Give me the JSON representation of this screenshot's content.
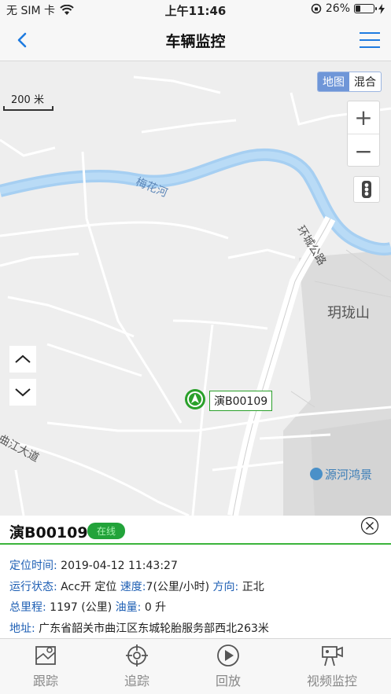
{
  "status_bar": {
    "carrier": "无 SIM 卡",
    "time": "上午11:46",
    "battery_percent": "26%",
    "battery_level": 0.26
  },
  "nav": {
    "title": "车辆监控",
    "back_icon": "chevron-left-icon",
    "menu_icon": "hamburger-menu-icon"
  },
  "map": {
    "scale_label": "200 米",
    "map_type": {
      "map_label": "地图",
      "hybrid_label": "混合",
      "selected": "地图"
    },
    "zoom_in": "+",
    "zoom_out": "−",
    "labels": {
      "river": "梅花河",
      "road_huancheng": "环城公路",
      "mountain": "玥珑山",
      "road_qujiang": "曲江大道",
      "poi": "源河鸿景"
    },
    "vehicle_label": "演B00109"
  },
  "info": {
    "plate": "演B00109",
    "status": "在线",
    "rows": {
      "locate_time_label": "定位时间:",
      "locate_time": "2019-04-12 11:43:27",
      "run_state_label": "运行状态:",
      "run_state": "Acc开 定位",
      "speed_label": "速度:",
      "speed": "7(公里/小时)",
      "direction_label": "方向:",
      "direction": "正北",
      "mileage_label": "总里程:",
      "mileage": "1197 (公里)",
      "fuel_label": "油量:",
      "fuel": "0 升",
      "address_label": "地址:",
      "address": "广东省韶关市曲江区东城轮胎服务部西北263米"
    }
  },
  "tabs": [
    {
      "label": "跟踪",
      "icon": "map-track-icon"
    },
    {
      "label": "追踪",
      "icon": "crosshair-icon"
    },
    {
      "label": "回放",
      "icon": "play-circle-icon"
    },
    {
      "label": "视频监控",
      "icon": "video-camera-icon"
    }
  ],
  "colors": {
    "accent_blue": "#1e7be0",
    "river": "#a6cff2",
    "online_green": "#22a33a",
    "label_blue": "#1e5fb4"
  }
}
